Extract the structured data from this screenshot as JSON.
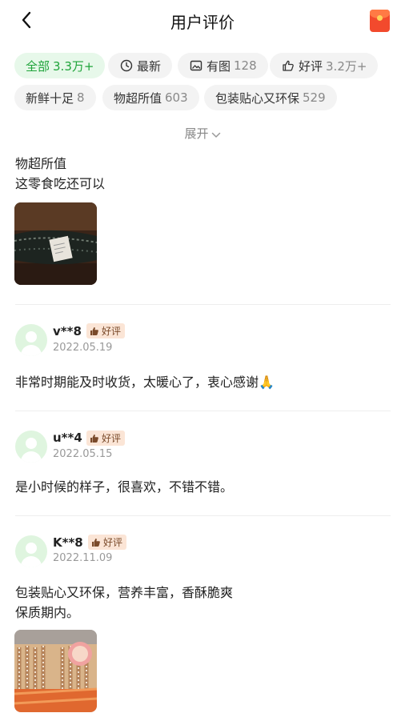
{
  "header": {
    "title": "用户评价",
    "back_icon": "chevron-left-icon",
    "redpacket_icon": "red-packet-icon"
  },
  "filters": [
    {
      "label": "全部",
      "count": "3.3万+",
      "active": true
    },
    {
      "label": "最新",
      "count": "",
      "icon": "clock-icon"
    },
    {
      "label": "有图",
      "count": "128",
      "icon": "image-icon"
    },
    {
      "label": "好评",
      "count": "3.2万+",
      "icon": "thumbs-up-icon"
    },
    {
      "label": "新鲜十足",
      "count": "8"
    },
    {
      "label": "物超所值",
      "count": "603"
    },
    {
      "label": "包装贴心又环保",
      "count": "529"
    }
  ],
  "expand_label": "展开",
  "reviews": [
    {
      "lines": [
        "物超所值",
        "这零食吃还可以"
      ],
      "has_photo": true
    },
    {
      "user": "v**8",
      "badge": "好评",
      "date": "2022.05.19",
      "text": "非常时期能及时收货，太暖心了，衷心感谢🙏"
    },
    {
      "user": "u**4",
      "badge": "好评",
      "date": "2022.05.15",
      "text": "是小时候的样子，很喜欢，不错不错。"
    },
    {
      "user": "K**8",
      "badge": "好评",
      "date": "2022.11.09",
      "lines": [
        "包装贴心又环保，营养丰富，香酥脆爽",
        "保质期内。"
      ],
      "has_photo": true
    }
  ],
  "colors": {
    "accent": "#1fa43a",
    "accent_bg": "#e7f8ea",
    "badge_bg": "#fbe5d6",
    "badge_text": "#7a4a2a"
  }
}
